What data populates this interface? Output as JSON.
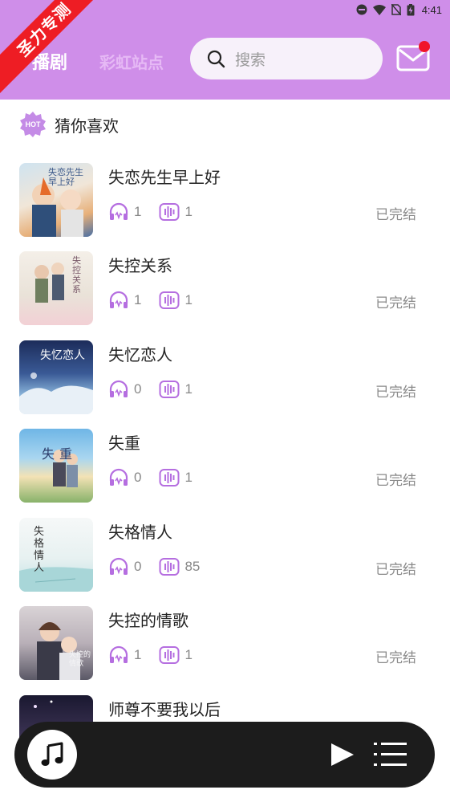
{
  "status_bar": {
    "time": "4:41"
  },
  "ribbon": "圣力专测",
  "tabs": [
    {
      "label": "播剧",
      "active": true
    },
    {
      "label": "彩虹站点",
      "active": false
    }
  ],
  "search": {
    "placeholder": "搜索"
  },
  "colors": {
    "header": "#cf8ee9",
    "accent": "#b56ee0",
    "badge": "#f0142a"
  },
  "section": {
    "badge": "HOT",
    "title": "猜你喜欢"
  },
  "items": [
    {
      "title": "失恋先生早上好",
      "listens": "1",
      "episodes": "1",
      "status": "已完结",
      "cover_icon": "cover-anime-couple"
    },
    {
      "title": "失控关系",
      "listens": "1",
      "episodes": "1",
      "status": "已完结",
      "cover_icon": "cover-anime-couple"
    },
    {
      "title": "失忆恋人",
      "listens": "0",
      "episodes": "1",
      "status": "已完结",
      "cover_icon": "cover-sky-scene"
    },
    {
      "title": "失重",
      "listens": "0",
      "episodes": "1",
      "status": "已完结",
      "cover_icon": "cover-anime-couple"
    },
    {
      "title": "失格情人",
      "listens": "0",
      "episodes": "85",
      "status": "已完结",
      "cover_icon": "cover-pale-sketch"
    },
    {
      "title": "失控的情歌",
      "listens": "1",
      "episodes": "1",
      "status": "已完结",
      "cover_icon": "cover-anime-couple"
    },
    {
      "title": "师尊不要我以后",
      "listens": "",
      "episodes": "",
      "status": "",
      "cover_icon": "cover-night-scene"
    }
  ],
  "cover_text": [
    "失恋先生 早上好",
    "失控关系",
    "失忆恋人",
    "失重",
    "失 格 情 人",
    "失控的情歌",
    ""
  ]
}
